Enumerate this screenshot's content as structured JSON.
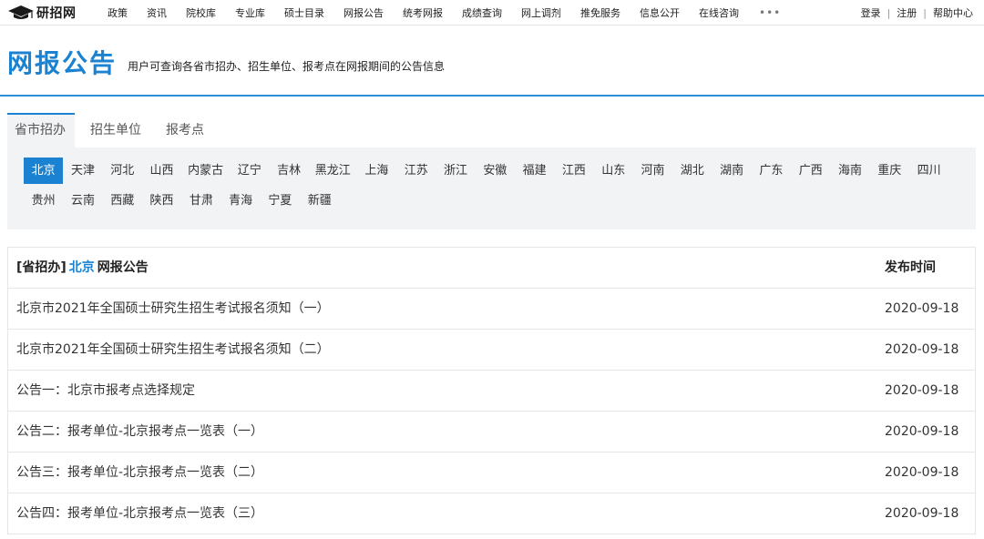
{
  "brand": {
    "logo_text": "研招网"
  },
  "nav": {
    "items": [
      "政策",
      "资讯",
      "院校库",
      "专业库",
      "硕士目录",
      "网报公告",
      "统考网报",
      "成绩查询",
      "网上调剂",
      "推免服务",
      "信息公开",
      "在线咨询"
    ],
    "more": "•••"
  },
  "user_links": {
    "login": "登录",
    "register": "注册",
    "help": "帮助中心",
    "separator": "|"
  },
  "header": {
    "title": "网报公告",
    "description": "用户可查询各省市招办、招生单位、报考点在网报期间的公告信息"
  },
  "tabs": [
    "省市招办",
    "招生单位",
    "报考点"
  ],
  "active_tab": "省市招办",
  "provinces_row1": [
    "北京",
    "天津",
    "河北",
    "山西",
    "内蒙古",
    "辽宁",
    "吉林",
    "黑龙江",
    "上海",
    "江苏",
    "浙江",
    "安徽",
    "福建",
    "江西",
    "山东",
    "河南",
    "湖北",
    "湖南",
    "广东",
    "广西",
    "海南",
    "重庆",
    "四川"
  ],
  "provinces_row2": [
    "贵州",
    "云南",
    "西藏",
    "陕西",
    "甘肃",
    "青海",
    "宁夏",
    "新疆"
  ],
  "active_province": "北京",
  "table": {
    "header": {
      "prefix": "[省招办]",
      "city": "北京",
      "suffix": "网报公告",
      "date_label": "发布时间"
    },
    "rows": [
      {
        "title": "北京市2021年全国硕士研究生招生考试报名须知（一）",
        "date": "2020-09-18"
      },
      {
        "title": "北京市2021年全国硕士研究生招生考试报名须知（二）",
        "date": "2020-09-18"
      },
      {
        "title": "公告一：北京市报考点选择规定",
        "date": "2020-09-18"
      },
      {
        "title": "公告二：报考单位-北京报考点一览表（一）",
        "date": "2020-09-18"
      },
      {
        "title": "公告三：报考单位-北京报考点一览表（二）",
        "date": "2020-09-18"
      },
      {
        "title": "公告四：报考单位-北京报考点一览表（三）",
        "date": "2020-09-18"
      }
    ]
  },
  "colors": {
    "accent": "#1b82d2",
    "panel_bg": "#f2f3f5",
    "border": "#e6e6e6"
  },
  "icons": {
    "logo": "graduation-cap-icon"
  }
}
